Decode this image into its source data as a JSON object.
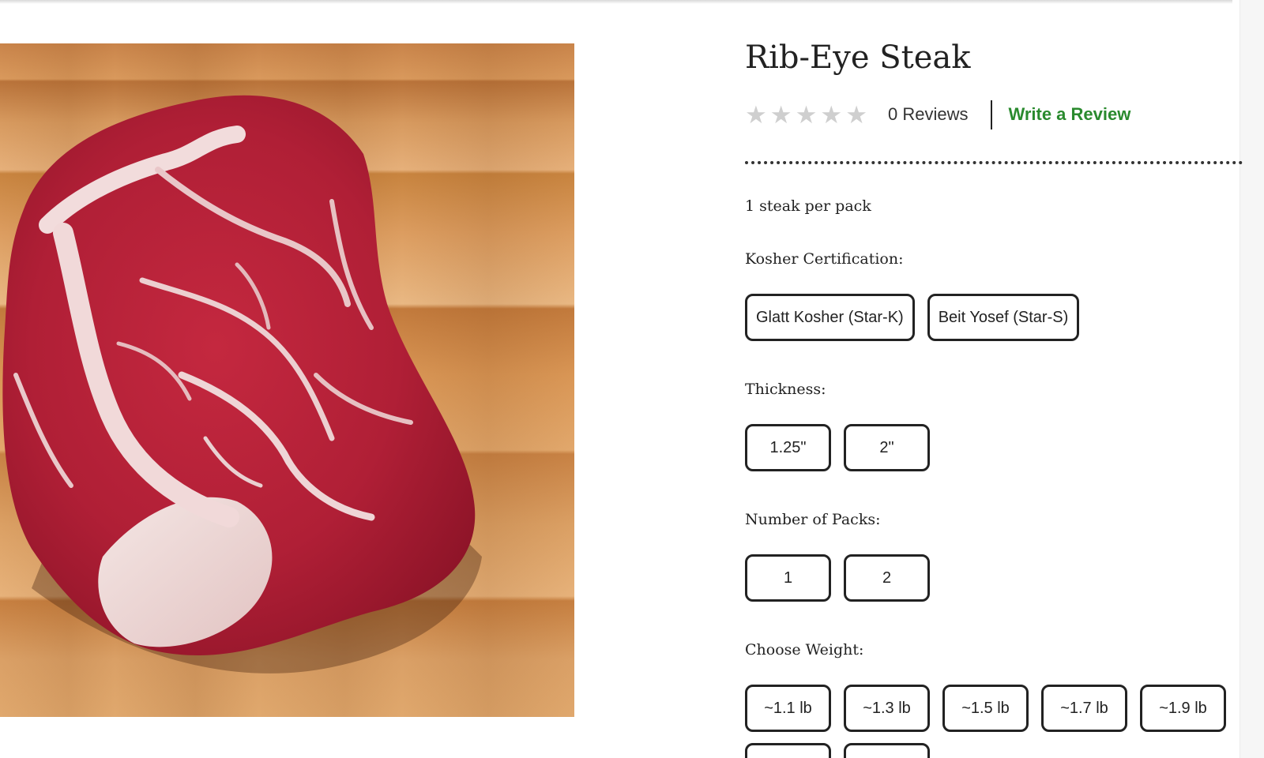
{
  "product": {
    "title": "Rib-Eye Steak",
    "image_alt": "Raw rib-eye steak on a wooden cutting board"
  },
  "rating": {
    "stars_filled": 0,
    "stars_total": 5,
    "reviews_label": "0 Reviews",
    "write_review_label": "Write a Review"
  },
  "pack_info": "1 steak per pack",
  "options": {
    "kosher": {
      "label": "Kosher Certification:",
      "choices": [
        "Glatt Kosher (Star-K)",
        "Beit Yosef (Star-S)"
      ]
    },
    "thickness": {
      "label": "Thickness:",
      "choices": [
        "1.25\"",
        "2\""
      ]
    },
    "packs": {
      "label": "Number of Packs:",
      "choices": [
        "1",
        "2"
      ]
    },
    "weight": {
      "label": "Choose Weight:",
      "choices": [
        "~1.1 lb",
        "~1.3 lb",
        "~1.5 lb",
        "~1.7 lb",
        "~1.9 lb"
      ]
    }
  },
  "colors": {
    "accent_green": "#2a8a2e",
    "star_empty": "#cfcfcf",
    "text": "#222222"
  },
  "icons": {
    "star": "star-icon"
  }
}
